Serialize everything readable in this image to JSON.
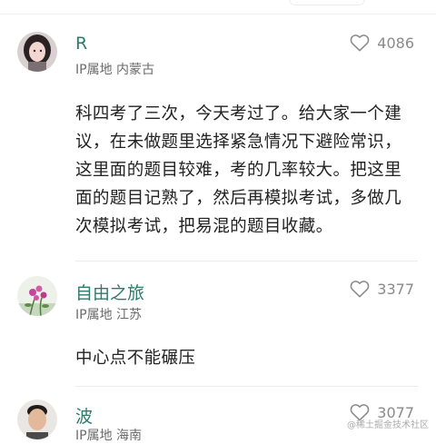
{
  "comments": [
    {
      "user": "R",
      "ip": "IP属地 内蒙古",
      "likes": "4086",
      "text": "科四考了三次，今天考过了。给大家一个建议，在未做题里选择紧急情况下避险常识，这里面的题目较难，考的几率较大。把这里面的题目记熟了，然后再模拟考试，多做几次模拟考试，把易混的题目收藏。"
    },
    {
      "user": "自由之旅",
      "ip": "IP属地 江苏",
      "likes": "3377",
      "text": "中心点不能碾压"
    },
    {
      "user": "波",
      "ip": "IP属地 海南",
      "likes": "3077"
    }
  ],
  "watermark": "@稀土掘金技术社区",
  "icons": {
    "like": "heart-outline-icon"
  },
  "colors": {
    "username": "#2e7a6c",
    "meta": "#6b6b6b",
    "like": "#8a8a8a"
  }
}
